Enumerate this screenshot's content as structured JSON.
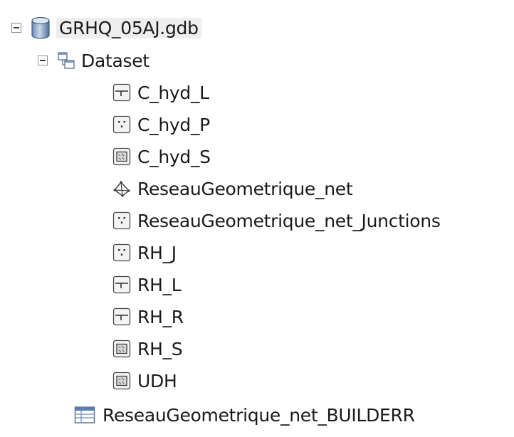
{
  "tree": {
    "root": {
      "label": "GRHQ_05AJ.gdb",
      "icon": "database-icon",
      "expanded": true
    },
    "dataset": {
      "label": "Dataset",
      "icon": "feature-dataset-icon",
      "expanded": true,
      "children": [
        {
          "label": "C_hyd_L",
          "icon": "line-feature-class-icon"
        },
        {
          "label": "C_hyd_P",
          "icon": "point-feature-class-icon"
        },
        {
          "label": "C_hyd_S",
          "icon": "polygon-feature-class-icon"
        },
        {
          "label": "ReseauGeometrique_net",
          "icon": "geometric-network-icon"
        },
        {
          "label": "ReseauGeometrique_net_Junctions",
          "icon": "point-feature-class-icon"
        },
        {
          "label": "RH_J",
          "icon": "point-feature-class-icon"
        },
        {
          "label": "RH_L",
          "icon": "line-feature-class-icon"
        },
        {
          "label": "RH_R",
          "icon": "line-feature-class-icon"
        },
        {
          "label": "RH_S",
          "icon": "polygon-feature-class-icon"
        },
        {
          "label": "UDH",
          "icon": "polygon-feature-class-icon"
        }
      ]
    },
    "table": {
      "label": "ReseauGeometrique_net_BUILDERR",
      "icon": "table-icon"
    }
  }
}
